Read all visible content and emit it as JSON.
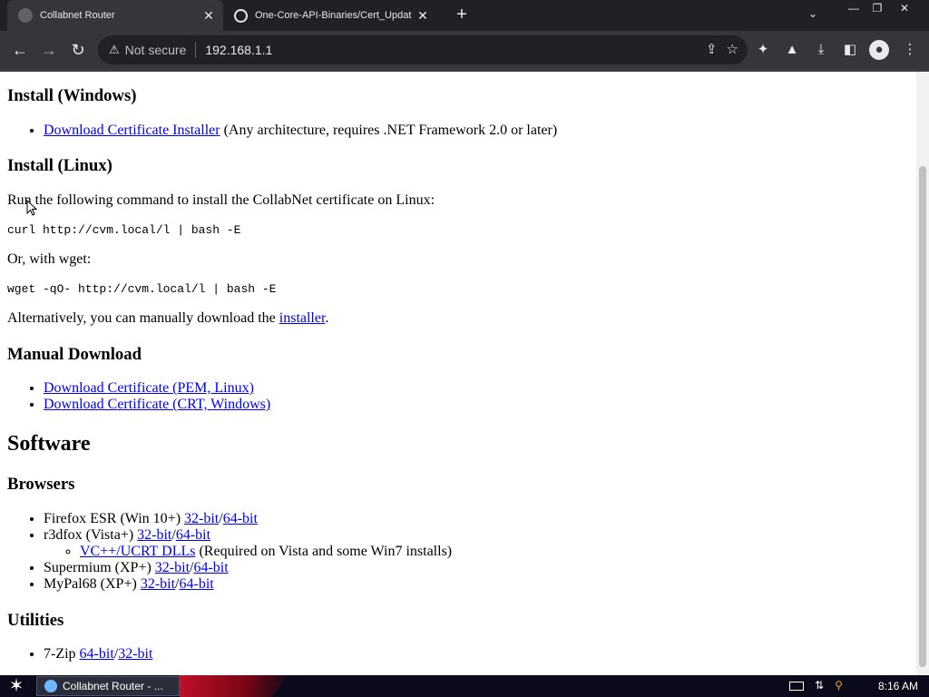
{
  "tabs": [
    {
      "title": "Collabnet Router",
      "active": true
    },
    {
      "title": "One-Core-API-Binaries/Cert_Updat",
      "active": false
    }
  ],
  "omnibox": {
    "security": "Not secure",
    "url": "192.168.1.1"
  },
  "page": {
    "install_windows": {
      "heading": "Install (Windows)",
      "link": "Download Certificate Installer",
      "desc": "(Any architecture, requires .NET Framework 2.0 or later)"
    },
    "install_linux": {
      "heading": "Install (Linux)",
      "intro": "Run the following command to install the CollabNet certificate on Linux:",
      "cmd_curl": "curl http://cvm.local/l | bash -E",
      "or_wget": "Or, with wget:",
      "cmd_wget": "wget -qO- http://cvm.local/l | bash -E",
      "alt_prefix": "Alternatively, you can manually download the ",
      "alt_link": "installer",
      "alt_suffix": "."
    },
    "manual": {
      "heading": "Manual Download",
      "items": [
        "Download Certificate (PEM, Linux)",
        "Download Certificate (CRT, Windows)"
      ]
    },
    "software": {
      "heading": "Software",
      "browsers": {
        "heading": "Browsers",
        "firefox": {
          "label": "Firefox ESR (Win 10+) ",
          "l32": "32-bit",
          "l64": "64-bit"
        },
        "r3dfox": {
          "label": "r3dfox (Vista+) ",
          "l32": "32-bit",
          "l64": "64-bit"
        },
        "vcpp": {
          "link": "VC++/UCRT DLLs",
          "desc": " (Required on Vista and some Win7 installs)"
        },
        "supermium": {
          "label": "Supermium (XP+) ",
          "l32": "32-bit",
          "l64": "64-bit"
        },
        "mypal": {
          "label": "MyPal68 (XP+) ",
          "l32": "32-bit",
          "l64": "64-bit"
        }
      },
      "utilities": {
        "heading": "Utilities",
        "sevenzip": {
          "label": "7-Zip ",
          "l64": "64-bit",
          "l32": "32-bit"
        }
      },
      "slash": "/"
    }
  },
  "taskbar": {
    "item": "Collabnet Router - ...",
    "clock": "8:16 AM"
  }
}
